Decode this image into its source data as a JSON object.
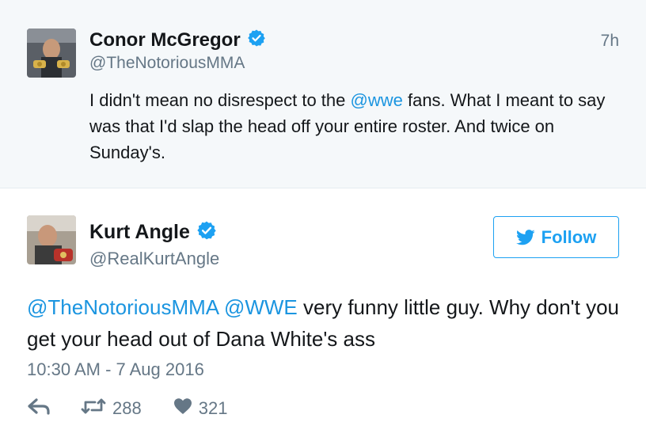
{
  "parent_tweet": {
    "author_name": "Conor McGregor",
    "handle": "@TheNotoriousMMA",
    "time_ago": "7h",
    "text_parts": {
      "a": "I didn't mean no disrespect to the ",
      "mention": "@wwe",
      "b": " fans. What I meant to say was that I'd slap the head off your entire roster. And twice on Sunday's."
    },
    "verified": true
  },
  "tweet": {
    "author_name": "Kurt Angle",
    "handle": "@RealKurtAngle",
    "verified": true,
    "follow_label": "Follow",
    "text_parts": {
      "mention1": "@TheNotoriousMMA",
      "mention2": "@WWE",
      "body": " very funny little guy. Why don't you get your head out of Dana White's ass"
    },
    "timestamp": "10:30 AM - 7 Aug 2016",
    "retweet_count": "288",
    "like_count": "321"
  },
  "colors": {
    "accent": "#1da1f2",
    "mention": "#1b95e0",
    "muted": "#657786",
    "parent_background": "#f5f8fa"
  },
  "icons": [
    "verified-badge-icon",
    "twitter-bird-icon",
    "reply-icon",
    "retweet-icon",
    "heart-icon"
  ]
}
